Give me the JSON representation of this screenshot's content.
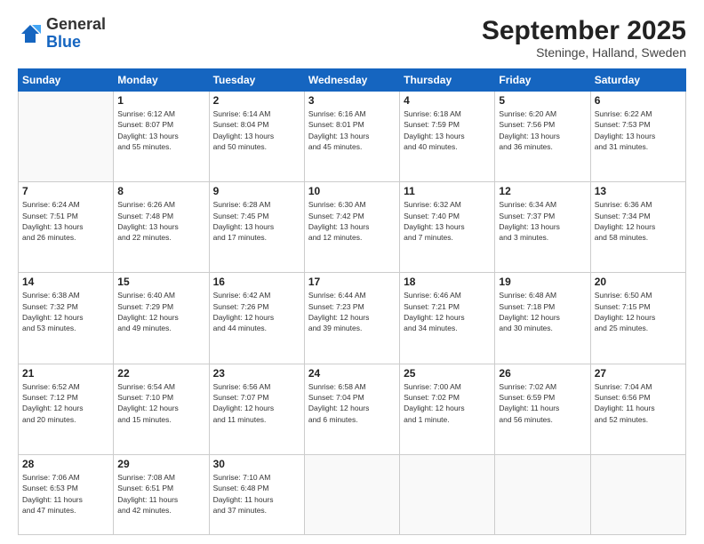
{
  "logo": {
    "general": "General",
    "blue": "Blue"
  },
  "header": {
    "month": "September 2025",
    "location": "Steninge, Halland, Sweden"
  },
  "weekdays": [
    "Sunday",
    "Monday",
    "Tuesday",
    "Wednesday",
    "Thursday",
    "Friday",
    "Saturday"
  ],
  "weeks": [
    [
      {
        "day": "",
        "info": ""
      },
      {
        "day": "1",
        "info": "Sunrise: 6:12 AM\nSunset: 8:07 PM\nDaylight: 13 hours\nand 55 minutes."
      },
      {
        "day": "2",
        "info": "Sunrise: 6:14 AM\nSunset: 8:04 PM\nDaylight: 13 hours\nand 50 minutes."
      },
      {
        "day": "3",
        "info": "Sunrise: 6:16 AM\nSunset: 8:01 PM\nDaylight: 13 hours\nand 45 minutes."
      },
      {
        "day": "4",
        "info": "Sunrise: 6:18 AM\nSunset: 7:59 PM\nDaylight: 13 hours\nand 40 minutes."
      },
      {
        "day": "5",
        "info": "Sunrise: 6:20 AM\nSunset: 7:56 PM\nDaylight: 13 hours\nand 36 minutes."
      },
      {
        "day": "6",
        "info": "Sunrise: 6:22 AM\nSunset: 7:53 PM\nDaylight: 13 hours\nand 31 minutes."
      }
    ],
    [
      {
        "day": "7",
        "info": "Sunrise: 6:24 AM\nSunset: 7:51 PM\nDaylight: 13 hours\nand 26 minutes."
      },
      {
        "day": "8",
        "info": "Sunrise: 6:26 AM\nSunset: 7:48 PM\nDaylight: 13 hours\nand 22 minutes."
      },
      {
        "day": "9",
        "info": "Sunrise: 6:28 AM\nSunset: 7:45 PM\nDaylight: 13 hours\nand 17 minutes."
      },
      {
        "day": "10",
        "info": "Sunrise: 6:30 AM\nSunset: 7:42 PM\nDaylight: 13 hours\nand 12 minutes."
      },
      {
        "day": "11",
        "info": "Sunrise: 6:32 AM\nSunset: 7:40 PM\nDaylight: 13 hours\nand 7 minutes."
      },
      {
        "day": "12",
        "info": "Sunrise: 6:34 AM\nSunset: 7:37 PM\nDaylight: 13 hours\nand 3 minutes."
      },
      {
        "day": "13",
        "info": "Sunrise: 6:36 AM\nSunset: 7:34 PM\nDaylight: 12 hours\nand 58 minutes."
      }
    ],
    [
      {
        "day": "14",
        "info": "Sunrise: 6:38 AM\nSunset: 7:32 PM\nDaylight: 12 hours\nand 53 minutes."
      },
      {
        "day": "15",
        "info": "Sunrise: 6:40 AM\nSunset: 7:29 PM\nDaylight: 12 hours\nand 49 minutes."
      },
      {
        "day": "16",
        "info": "Sunrise: 6:42 AM\nSunset: 7:26 PM\nDaylight: 12 hours\nand 44 minutes."
      },
      {
        "day": "17",
        "info": "Sunrise: 6:44 AM\nSunset: 7:23 PM\nDaylight: 12 hours\nand 39 minutes."
      },
      {
        "day": "18",
        "info": "Sunrise: 6:46 AM\nSunset: 7:21 PM\nDaylight: 12 hours\nand 34 minutes."
      },
      {
        "day": "19",
        "info": "Sunrise: 6:48 AM\nSunset: 7:18 PM\nDaylight: 12 hours\nand 30 minutes."
      },
      {
        "day": "20",
        "info": "Sunrise: 6:50 AM\nSunset: 7:15 PM\nDaylight: 12 hours\nand 25 minutes."
      }
    ],
    [
      {
        "day": "21",
        "info": "Sunrise: 6:52 AM\nSunset: 7:12 PM\nDaylight: 12 hours\nand 20 minutes."
      },
      {
        "day": "22",
        "info": "Sunrise: 6:54 AM\nSunset: 7:10 PM\nDaylight: 12 hours\nand 15 minutes."
      },
      {
        "day": "23",
        "info": "Sunrise: 6:56 AM\nSunset: 7:07 PM\nDaylight: 12 hours\nand 11 minutes."
      },
      {
        "day": "24",
        "info": "Sunrise: 6:58 AM\nSunset: 7:04 PM\nDaylight: 12 hours\nand 6 minutes."
      },
      {
        "day": "25",
        "info": "Sunrise: 7:00 AM\nSunset: 7:02 PM\nDaylight: 12 hours\nand 1 minute."
      },
      {
        "day": "26",
        "info": "Sunrise: 7:02 AM\nSunset: 6:59 PM\nDaylight: 11 hours\nand 56 minutes."
      },
      {
        "day": "27",
        "info": "Sunrise: 7:04 AM\nSunset: 6:56 PM\nDaylight: 11 hours\nand 52 minutes."
      }
    ],
    [
      {
        "day": "28",
        "info": "Sunrise: 7:06 AM\nSunset: 6:53 PM\nDaylight: 11 hours\nand 47 minutes."
      },
      {
        "day": "29",
        "info": "Sunrise: 7:08 AM\nSunset: 6:51 PM\nDaylight: 11 hours\nand 42 minutes."
      },
      {
        "day": "30",
        "info": "Sunrise: 7:10 AM\nSunset: 6:48 PM\nDaylight: 11 hours\nand 37 minutes."
      },
      {
        "day": "",
        "info": ""
      },
      {
        "day": "",
        "info": ""
      },
      {
        "day": "",
        "info": ""
      },
      {
        "day": "",
        "info": ""
      }
    ]
  ]
}
